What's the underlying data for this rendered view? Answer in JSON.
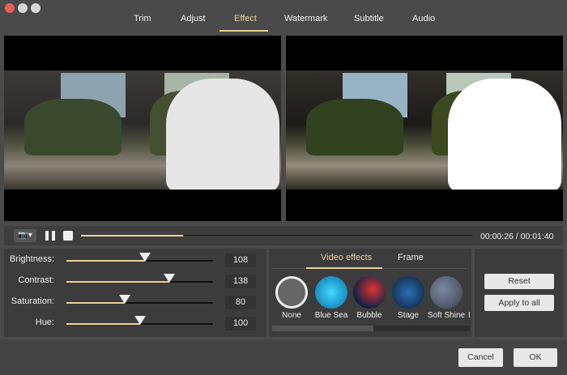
{
  "window": {
    "controls": {
      "close": "#ec5f55",
      "min": "#d6d6d6",
      "max": "#d6d6d6"
    }
  },
  "tabs": [
    {
      "label": "Trim"
    },
    {
      "label": "Adjust"
    },
    {
      "label": "Effect",
      "active": true
    },
    {
      "label": "Watermark"
    },
    {
      "label": "Subtitle"
    },
    {
      "label": "Audio"
    }
  ],
  "player": {
    "progress": 0.26,
    "time": "00:00:26 / 00:01:40",
    "icons": [
      "camera-icon",
      "pause-icon",
      "stop-icon"
    ]
  },
  "adjust": [
    {
      "label": "Brightness:",
      "value": "108",
      "fraction": 0.535
    },
    {
      "label": "Contrast:",
      "value": "138",
      "fraction": 0.7
    },
    {
      "label": "Saturation:",
      "value": "80",
      "fraction": 0.4
    },
    {
      "label": "Hue:",
      "value": "100",
      "fraction": 0.5
    }
  ],
  "effects": {
    "tabs": [
      {
        "label": "Video effects",
        "active": true
      },
      {
        "label": "Frame"
      }
    ],
    "items": [
      {
        "label": "None",
        "selected": true
      },
      {
        "label": "Blue Sea"
      },
      {
        "label": "Bubble"
      },
      {
        "label": "Stage"
      },
      {
        "label": "Soft Shine"
      },
      {
        "label": "I"
      }
    ]
  },
  "actions": {
    "reset": "Reset",
    "apply_all": "Apply to all",
    "cancel": "Cancel",
    "ok": "OK"
  },
  "accent": "#e8d29a"
}
